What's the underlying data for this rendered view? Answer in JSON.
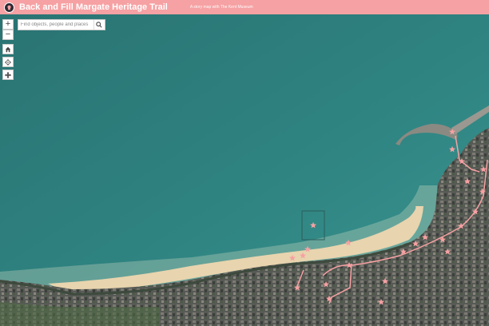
{
  "header": {
    "title": "Back and Fill Margate Heritage Trail",
    "subtitle": "A story map with The Kent Museum"
  },
  "search": {
    "placeholder": "Find objects, people and places"
  },
  "controls": {
    "zoom_in": "+",
    "zoom_out": "−",
    "icons": [
      "home-icon",
      "locate-icon",
      "pan-icon",
      "search-icon"
    ]
  },
  "colors": {
    "header": "#f6a1a3",
    "trail": "#f6a1a3",
    "sea": "#2d7c7c",
    "sand": "#e8d4ae"
  },
  "markers": {
    "count": 24
  }
}
